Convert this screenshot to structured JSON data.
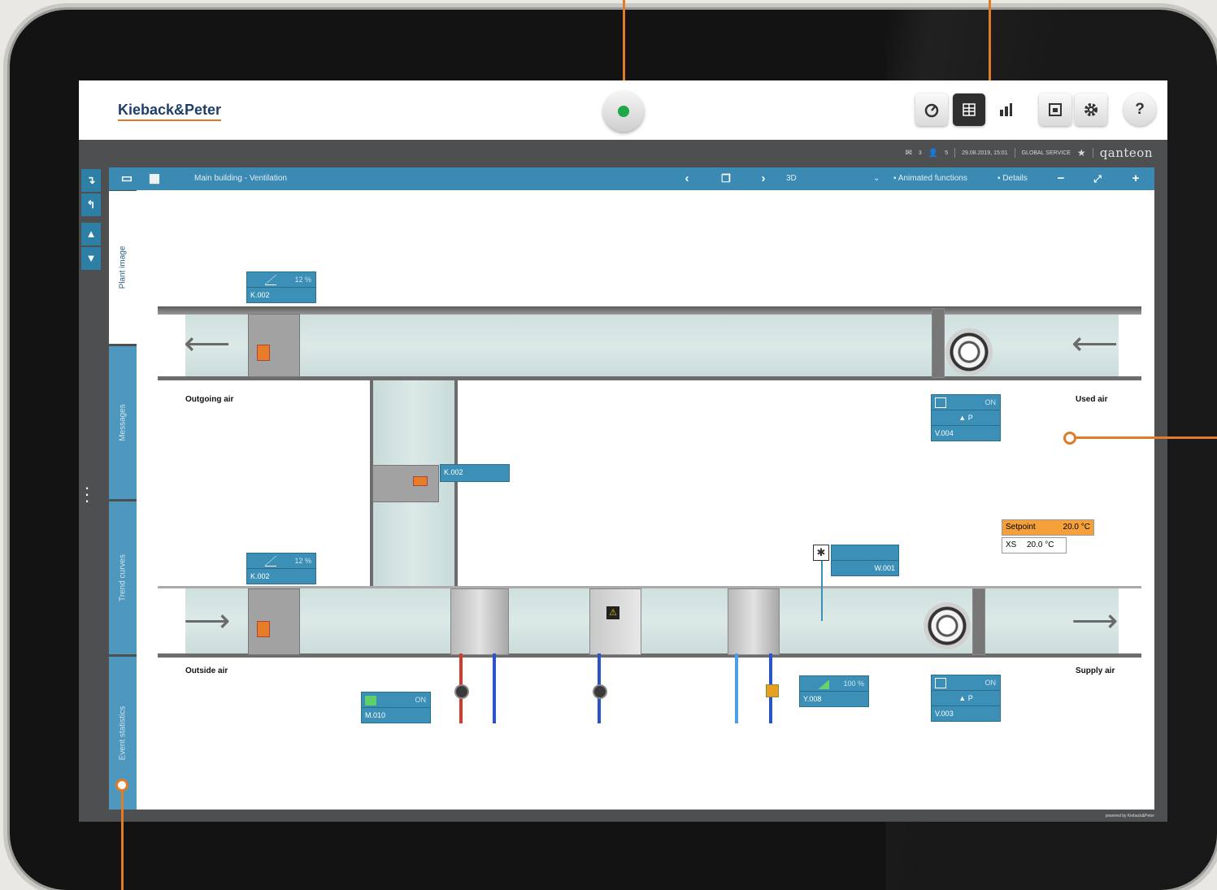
{
  "header": {
    "logo": "Kieback&Peter",
    "icons": [
      "gauge-icon",
      "plant-scheme-icon",
      "building-chart-icon",
      "window-icon",
      "gear-icon",
      "help-icon"
    ],
    "help_label": "?"
  },
  "infobar": {
    "messages_count": "3",
    "users_count": "5",
    "datetime": "29.08.2019, 15:01",
    "role": "GLOBAL SERVICE",
    "brand": "qanteon",
    "powered_by": "powered by Kieback&Peter"
  },
  "toolbar": {
    "breadcrumb": "Main building - Ventilation",
    "view_mode": "3D",
    "animated_label": "Animated functions",
    "details_label": "Details"
  },
  "tabs": [
    {
      "label": "Plant image",
      "active": true
    },
    {
      "label": "Messages"
    },
    {
      "label": "Trend curves"
    },
    {
      "label": "Event statistics"
    }
  ],
  "plant": {
    "labels": {
      "outgoing_air": "Outgoing air",
      "used_air": "Used air",
      "outside_air": "Outside air",
      "supply_air": "Supply air"
    },
    "damper_top": {
      "value": "12 %",
      "id": "K.002"
    },
    "damper_mid": {
      "id": "K.002"
    },
    "damper_bottom": {
      "value": "12 %",
      "id": "K.002"
    },
    "fan_top": {
      "state": "ON",
      "mode": "▲ P",
      "id": "V.004"
    },
    "fan_bottom": {
      "state": "ON",
      "mode": "▲ P",
      "id": "V.003"
    },
    "w001": {
      "id": "W.001"
    },
    "pump": {
      "state": "ON",
      "id": "M.010"
    },
    "valve": {
      "value": "100 %",
      "id": "Y.008"
    },
    "setpoint": {
      "label": "Setpoint",
      "value": "20.0 °C",
      "xs_label": "XS",
      "xs_value": "20.0 °C"
    }
  },
  "colors": {
    "accent": "#3a8ab3",
    "status_ok": "#1ea84a",
    "annotation": "#e07b2a",
    "setpoint": "#f5a03a"
  }
}
